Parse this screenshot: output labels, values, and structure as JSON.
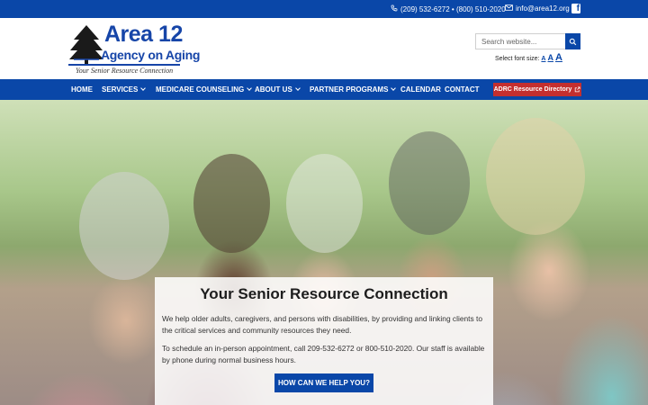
{
  "topbar": {
    "phone": "(209) 532-6272 • (800) 510-2020",
    "email": "info@area12.org",
    "facebook_icon": "facebook-icon",
    "facebook_glyph": "f"
  },
  "logo": {
    "line1": "Area 12",
    "line2": "Agency on Aging",
    "tagline": "Your Senior Resource Connection"
  },
  "search": {
    "placeholder": "Search website...",
    "icon": "search-icon"
  },
  "font_size": {
    "label": "Select font size:",
    "small": "A",
    "medium": "A",
    "large": "A"
  },
  "nav": {
    "items": [
      {
        "label": "HOME"
      },
      {
        "label": "SERVICES"
      },
      {
        "label": "MEDICARE COUNSELING"
      },
      {
        "label": "ABOUT US"
      },
      {
        "label": "PARTNER PROGRAMS"
      },
      {
        "label": "CALENDAR"
      },
      {
        "label": "CONTACT"
      }
    ],
    "adrc_label": "ADRC Resource Directory",
    "adrc_icon": "external-link-icon"
  },
  "hero": {
    "title": "Your Senior Resource Connection",
    "paragraph1": "We help older adults, caregivers, and persons with disabilities, by providing and linking clients to the critical services and community resources they need.",
    "paragraph2": "To schedule an in-person appointment, call 209-532-6272 or 800-510-2020. Our staff is available by phone during normal business hours.",
    "cta_label": "HOW CAN WE HELP YOU?"
  },
  "colors": {
    "brand_blue": "#0a47a8",
    "adrc_red": "#c42f2f"
  }
}
